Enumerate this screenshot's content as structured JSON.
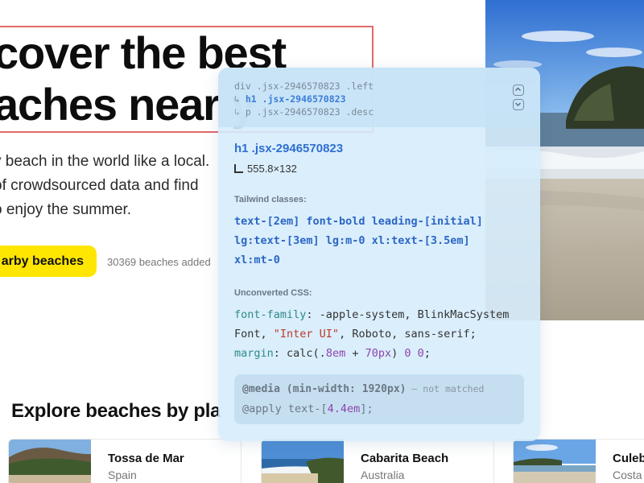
{
  "hero": {
    "title_line1": "cover the best",
    "title_line2": "aches near y",
    "desc_line1": "y beach in the world like a local.",
    "desc_line2": " of crowdsourced data and find",
    "desc_line3": "o enjoy the summer.",
    "cta_label": "arby beaches",
    "beach_count": "30369 beaches added"
  },
  "explore": {
    "title": "Explore beaches by pla",
    "cards": [
      {
        "name": "Tossa de Mar",
        "country": "Spain"
      },
      {
        "name": "Cabarita Beach",
        "country": "Australia"
      },
      {
        "name": "Culeb",
        "country": "Costa"
      }
    ]
  },
  "inspector": {
    "breadcrumb": {
      "line1": "div .jsx-2946570823 .left",
      "arrow": "↳",
      "line2": "h1 .jsx-2946570823",
      "line3": "p .jsx-2946570823 .desc"
    },
    "selected": "h1 .jsx-2946570823",
    "dimensions": "555.8×132",
    "tailwind_label": "Tailwind classes:",
    "tailwind_lines": [
      "text-[2em] font-bold leading-[initial]",
      "lg:text-[3em] lg:m-0 xl:text-[3.5em]",
      "xl:mt-0"
    ],
    "css_label": "Unconverted CSS:",
    "css": {
      "font_prop": "font-family",
      "font_val1": ": -apple-system, BlinkMacSystem",
      "font_val2a": "Font, ",
      "font_str": "\"Inter UI\"",
      "font_val2b": ", Roboto, sans-serif;",
      "margin_prop": "margin",
      "margin_a": ": calc(.",
      "margin_n1": "8em",
      "margin_b": " + ",
      "margin_n2": "70px",
      "margin_c": ") ",
      "margin_n3": "0",
      "margin_d": " ",
      "margin_n4": "0",
      "margin_e": ";"
    },
    "media": {
      "query": "@media (min-width: 1920px)",
      "note": " – not matched",
      "apply_a": "@apply text-[",
      "apply_num": "4.4em",
      "apply_b": "];"
    }
  },
  "colors": {
    "cta": "#ffe600",
    "highlight_border": "#e06a6a",
    "inspector_bg": "#d6ecfc",
    "tailwind_text": "#2c66c4"
  }
}
